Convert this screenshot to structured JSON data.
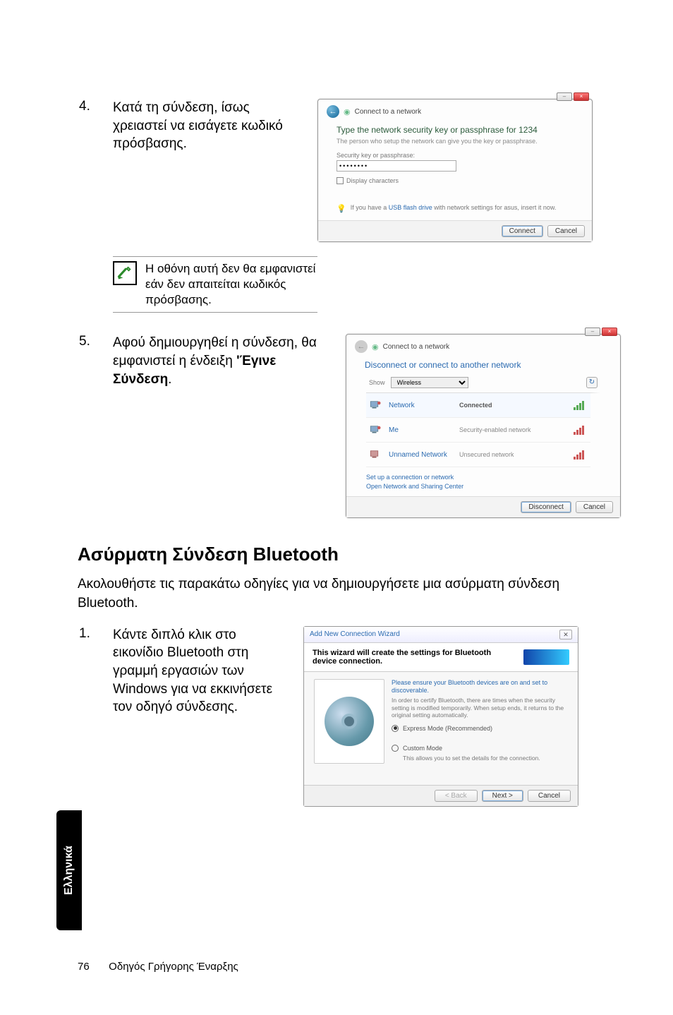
{
  "steps": {
    "s4": {
      "num": "4.",
      "text": "Κατά τη σύνδεση, ίσως χρειαστεί να εισάγετε κωδικό πρόσβασης."
    },
    "note": "Η οθόνη αυτή δεν θα εμφανιστεί εάν δεν απαιτείται κωδικός πρόσβασης.",
    "s5": {
      "num": "5.",
      "text_a": "Αφού δημιουργηθεί η σύνδεση, θα εμφανιστεί η ένδειξη ",
      "bold": "'Έγινε Σύνδεση",
      "text_b": "."
    },
    "s1bt": {
      "num": "1.",
      "text": "Κάντε διπλό κλικ στο εικονίδιο Bluetooth στη γραμμή εργασιών των Windows για να εκκινήσετε τον οδηγό σύνδεσης."
    }
  },
  "section": {
    "title": "Ασύρματη Σύνδεση Bluetooth",
    "intro": "Ακολουθήστε τις παρακάτω οδηγίες για να δημιουργήσετε μια ασύρματη σύνδεση Bluetooth."
  },
  "dialog_key": {
    "crumb": "Connect to a network",
    "title": "Type the network security key or passphrase for 1234",
    "sub": "The person who setup the network can give you the key or passphrase.",
    "field_label": "Security key or passphrase:",
    "field_value": "••••••••",
    "checkbox": "Display characters",
    "info_a": "If you have a ",
    "info_link": "USB flash drive",
    "info_b": " with network settings for asus, insert it now.",
    "btn_primary": "Connect",
    "btn_cancel": "Cancel"
  },
  "dialog_list": {
    "crumb": "Connect to a network",
    "title": "Disconnect or connect to another network",
    "show_label": "Show",
    "show_value": "Wireless",
    "items": [
      {
        "name": "Network",
        "status": "Connected",
        "status_bold": true,
        "sig": "green"
      },
      {
        "name": "Me",
        "status": "Security-enabled network",
        "status_bold": false,
        "sig": "red"
      },
      {
        "name": "Unnamed Network",
        "status": "Unsecured network",
        "status_bold": false,
        "sig": "red"
      }
    ],
    "link1": "Set up a connection or network",
    "link2": "Open Network and Sharing Center",
    "btn_primary": "Disconnect",
    "btn_cancel": "Cancel"
  },
  "dialog_bt": {
    "window_title": "Add New Connection Wizard",
    "banner": "This wizard will create the settings for Bluetooth device connection.",
    "p1": "Please ensure your Bluetooth devices are on and set to discoverable.",
    "p2": "In order to certify Bluetooth, there are times when the security setting is modified temporarily. When setup ends, it returns to the original setting automatically.",
    "opt1": "Express Mode (Recommended)",
    "opt2": "Custom Mode",
    "opt2_desc": "This allows you to set the details for the connection.",
    "btn_back": "< Back",
    "btn_next": "Next >",
    "btn_cancel": "Cancel"
  },
  "side_tab": "Ελληνικά",
  "footer": {
    "page": "76",
    "title": "Οδηγός Γρήγορης Έναρξης"
  }
}
